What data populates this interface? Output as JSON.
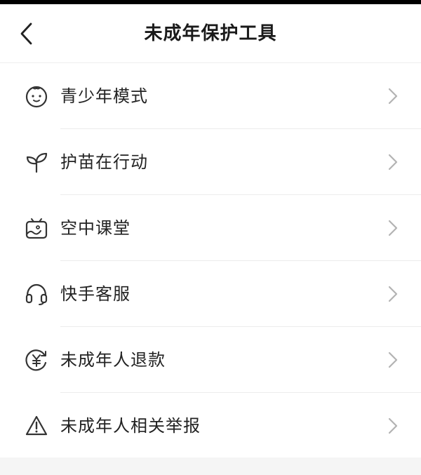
{
  "header": {
    "title": "未成年保护工具",
    "back_icon": "chevron-left-icon"
  },
  "menu": {
    "items": [
      {
        "label": "青少年模式",
        "icon": "baby-face-icon"
      },
      {
        "label": "护苗在行动",
        "icon": "sprout-icon"
      },
      {
        "label": "空中课堂",
        "icon": "classroom-icon"
      },
      {
        "label": "快手客服",
        "icon": "headset-icon"
      },
      {
        "label": "未成年人退款",
        "icon": "yuan-refund-icon"
      },
      {
        "label": "未成年人相关举报",
        "icon": "warning-icon"
      }
    ]
  },
  "colors": {
    "text": "#222222",
    "icon": "#333333",
    "chevron": "#b3b3b3",
    "divider": "#ececec",
    "background": "#f5f5f5"
  }
}
